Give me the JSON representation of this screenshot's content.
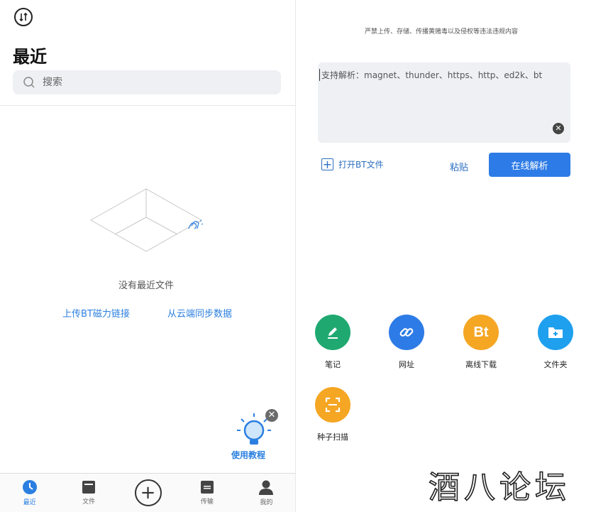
{
  "left": {
    "page_title": "最近",
    "search_placeholder": "搜索",
    "empty_text": "没有最近文件",
    "link_upload": "上传BT磁力链接",
    "link_sync": "从云端同步数据",
    "tutorial_label": "使用教程",
    "tabs": [
      {
        "label": "最近",
        "icon": "clock-icon"
      },
      {
        "label": "文件",
        "icon": "folder-icon"
      },
      {
        "label": "",
        "icon": "add-icon"
      },
      {
        "label": "传输",
        "icon": "transfer-icon"
      },
      {
        "label": "我的",
        "icon": "user-icon"
      }
    ]
  },
  "right": {
    "notice": "严禁上传、存储、传播黄赌毒以及侵权等违法违规内容",
    "input_placeholder": "支持解析：magnet、thunder、https、http、ed2k、bt",
    "open_bt_label": "打开BT文件",
    "paste_label": "粘贴",
    "parse_label": "在线解析",
    "tools": [
      {
        "label": "笔记",
        "icon": "pencil-icon",
        "color": "#1fa971"
      },
      {
        "label": "网址",
        "icon": "link-icon",
        "color": "#2d7be6"
      },
      {
        "label": "离线下载",
        "icon": "bt-icon",
        "color": "#f5a623"
      },
      {
        "label": "文件夹",
        "icon": "folder-add-icon",
        "color": "#1ea0ee"
      },
      {
        "label": "种子扫描",
        "icon": "scan-icon",
        "color": "#f5a623"
      }
    ]
  },
  "watermark": "酒八论坛",
  "colors": {
    "accent": "#2d7be6",
    "link": "#2b7fe0"
  }
}
